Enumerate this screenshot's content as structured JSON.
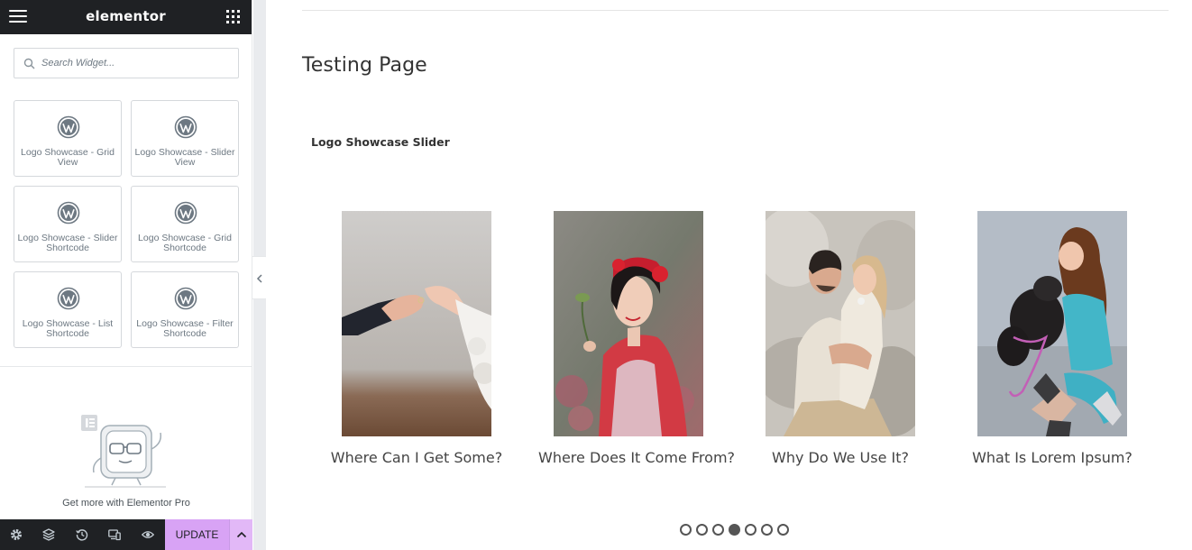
{
  "panel": {
    "brand": "elementor",
    "search": {
      "placeholder": "Search Widget..."
    },
    "widgets": [
      {
        "label": "Logo Showcase - Grid View",
        "icon": "wordpress-icon"
      },
      {
        "label": "Logo Showcase - Slider View",
        "icon": "wordpress-icon"
      },
      {
        "label": "Logo Showcase - Slider Shortcode",
        "icon": "wordpress-icon"
      },
      {
        "label": "Logo Showcase - Grid Shortcode",
        "icon": "wordpress-icon"
      },
      {
        "label": "Logo Showcase - List Shortcode",
        "icon": "wordpress-icon"
      },
      {
        "label": "Logo Showcase - Filter Shortcode",
        "icon": "wordpress-icon"
      }
    ],
    "promo_text": "Get more with Elementor Pro",
    "footer": {
      "icons": [
        "settings-icon",
        "navigator-icon",
        "history-icon",
        "responsive-icon",
        "preview-icon"
      ],
      "update_label": "UPDATE"
    }
  },
  "preview": {
    "page_title": "Testing Page",
    "widget_heading": "Logo Showcase Slider",
    "slides": [
      {
        "caption": "Where Can I Get Some?",
        "image": "hands-holding-ring-photo"
      },
      {
        "caption": "Where Does It Come From?",
        "image": "woman-red-flower-headband-photo"
      },
      {
        "caption": "Why Do We Use It?",
        "image": "couple-embracing-on-rocks-photo"
      },
      {
        "caption": "What Is Lorem Ipsum?",
        "image": "girl-hugging-black-dog-photo"
      }
    ],
    "pagination": {
      "total": 7,
      "active_index": 3
    }
  },
  "colors": {
    "panel_header": "#1f2124",
    "update_button": "#d8a3f5",
    "gutter": "#e9ebee",
    "muted_text": "#6d7882"
  }
}
